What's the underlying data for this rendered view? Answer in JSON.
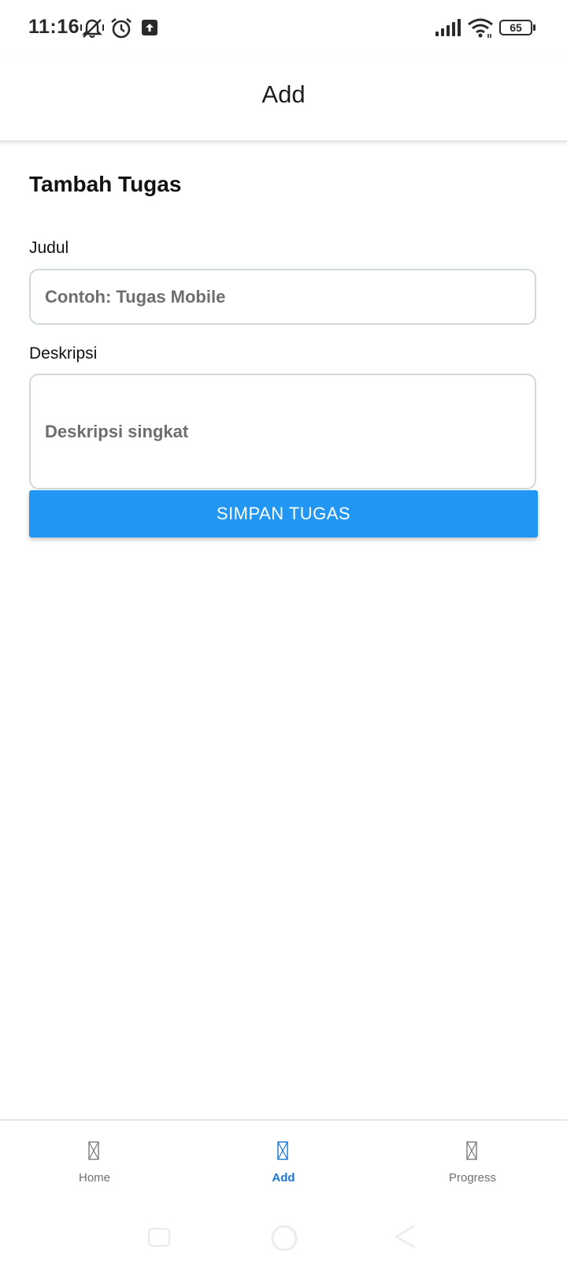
{
  "status_bar": {
    "time": "11:16",
    "battery": "65",
    "icons": [
      "mute-vibrate-icon",
      "alarm-icon",
      "upload-icon",
      "signal-icon",
      "wifi-icon",
      "battery-icon"
    ]
  },
  "app_bar": {
    "title": "Add"
  },
  "form": {
    "title": "Tambah Tugas",
    "judul": {
      "label": "Judul",
      "placeholder": "Contoh: Tugas Mobile",
      "value": ""
    },
    "deskripsi": {
      "label": "Deskripsi",
      "placeholder": "Deskripsi singkat",
      "value": ""
    },
    "save_label": "SIMPAN TUGAS"
  },
  "bottom_nav": {
    "items": [
      {
        "label": "Home",
        "icon": "missing-glyph-icon",
        "active": false
      },
      {
        "label": "Add",
        "icon": "missing-glyph-icon",
        "active": true
      },
      {
        "label": "Progress",
        "icon": "missing-glyph-icon",
        "active": false
      }
    ]
  },
  "colors": {
    "primary": "#2196f3",
    "nav_active": "#1976d2",
    "nav_inactive": "#6f6f6f",
    "input_border": "#cfd8dc"
  }
}
